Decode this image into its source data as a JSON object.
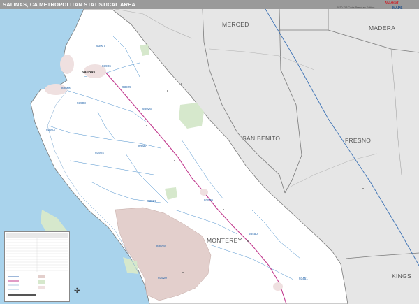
{
  "title": "SALINAS, CA METROPOLITAN STATISTICAL AREA",
  "edition": "2020 ZIP Code Premium Edition",
  "logo": {
    "name": "Market",
    "sub": "MAPS"
  },
  "counties": {
    "merced": "MERCED",
    "madera": "MADERA",
    "san_benito": "SAN BENITO",
    "fresno": "FRESNO",
    "monterey": "MONTEREY",
    "kings": "KINGS"
  },
  "cities": {
    "salinas": "Salinas"
  },
  "zip_codes": {
    "z93907": "93907",
    "z93906": "93906",
    "z93925": "93925",
    "z93955": "93955",
    "z93908": "93908",
    "z93926": "93926",
    "z93923": "93923",
    "z93924": "93924",
    "z93960": "93960",
    "z93927": "93927",
    "z93930": "93930",
    "z93450": "93450",
    "z93928": "93928",
    "z93920": "93920",
    "z93451": "93451"
  },
  "colors": {
    "ocean": "#a9d3ec",
    "surrounding_land": "#e6e6e6",
    "study_area": "#ffffff",
    "military_land": "#e3cfcc",
    "park_land": "#d6e8cc",
    "zip_boundary": "#4a8fcc",
    "highway": "#c23a8e",
    "county_boundary": "#7a7a7a",
    "header": "#9a9a9a"
  }
}
